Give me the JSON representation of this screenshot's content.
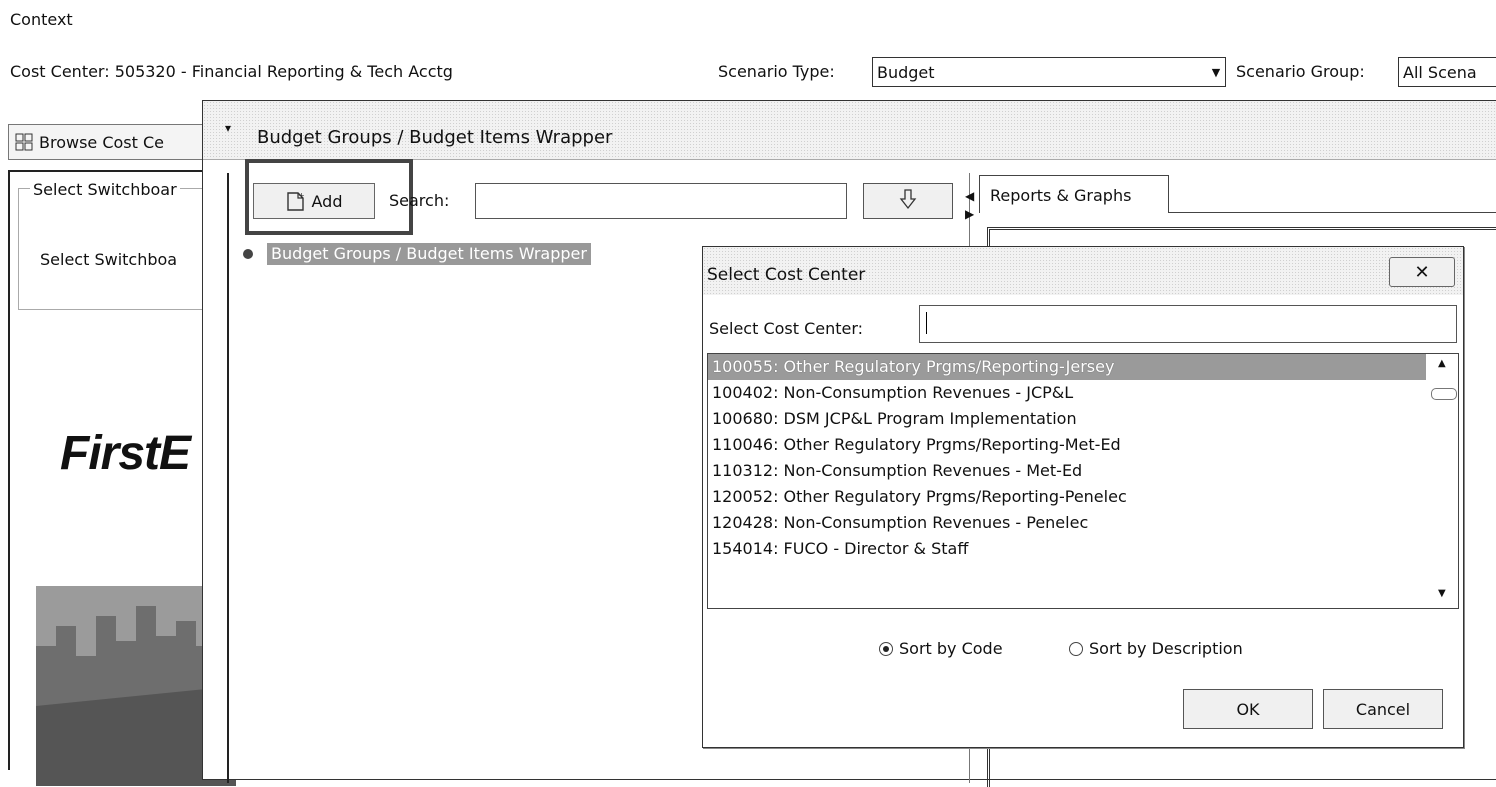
{
  "context": {
    "title": "Context",
    "cost_center_label": "Cost Center: 505320 - Financial Reporting & Tech Acctg",
    "scenario_type_label": "Scenario Type:",
    "scenario_type_value": "Budget",
    "scenario_group_label": "Scenario Group:",
    "scenario_group_value": "All Scena"
  },
  "left_panel": {
    "browse_button": "Browse Cost Ce",
    "switchboard_group_title": "Select Switchboar",
    "switchboard_label": "Select Switchboa",
    "logo_text": "FirstE"
  },
  "wrapper": {
    "title": "Budget Groups / Budget Items Wrapper",
    "add_button": "Add",
    "search_label": "Search:",
    "search_value": "",
    "tree_item": "Budget Groups / Budget Items Wrapper",
    "reports_tab": "Reports & Graphs"
  },
  "dialog": {
    "title": "Select Cost Center",
    "field_label": "Select Cost Center:",
    "field_value": "",
    "items": [
      "100055: Other Regulatory Prgms/Reporting-Jersey",
      "100402: Non-Consumption Revenues - JCP&L",
      "100680: DSM JCP&L Program Implementation",
      "110046: Other Regulatory Prgms/Reporting-Met-Ed",
      "110312: Non-Consumption Revenues - Met-Ed",
      "120052: Other Regulatory Prgms/Reporting-Penelec",
      "120428: Non-Consumption Revenues - Penelec",
      "154014: FUCO - Director & Staff"
    ],
    "selected_index": 0,
    "sort_by_code": "Sort by Code",
    "sort_by_description": "Sort by Description",
    "sort_selected": "code",
    "ok_button": "OK",
    "cancel_button": "Cancel"
  }
}
